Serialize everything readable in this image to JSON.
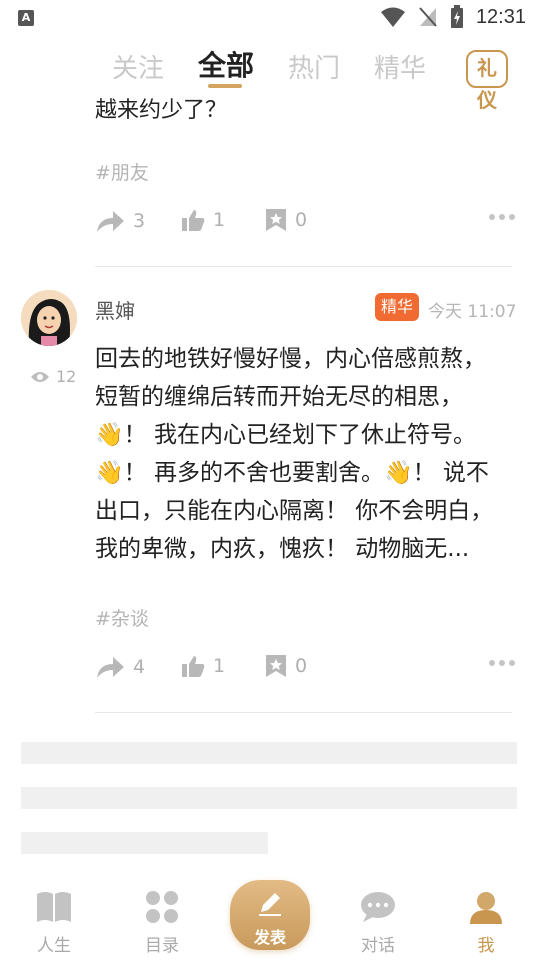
{
  "status": {
    "time": "12:31",
    "left_icon": "A"
  },
  "tabs": [
    {
      "label": "关注"
    },
    {
      "label": "全部"
    },
    {
      "label": "热门"
    },
    {
      "label": "精华"
    }
  ],
  "liyi_label": "礼仪",
  "post_prev": {
    "cut_text": "越来约少了？",
    "tag": "#朋友",
    "repost_count": "3",
    "like_count": "1",
    "fav_count": "0"
  },
  "post": {
    "author": "黑婶",
    "badge": "精华",
    "time": "今天 11:07",
    "views": "12",
    "lines": [
      "回去的地铁好慢好慢，内心倍感煎熬，",
      "短暂的缠绵后转而开始无尽的相思，",
      "👋！ 我在内心已经划下了休止符号。",
      "👋！ 再多的不舍也要割舍。👋！  说不",
      "出口，只能在内心隔离！ 你不会明白，",
      "我的卑微，内疚，愧疚！  动物脑无..."
    ],
    "tag": "#杂谈",
    "repost_count": "4",
    "like_count": "1",
    "fav_count": "0"
  },
  "nav": {
    "items": [
      {
        "label": "人生"
      },
      {
        "label": "目录"
      },
      {
        "label": "发表"
      },
      {
        "label": "对话"
      },
      {
        "label": "我"
      }
    ]
  },
  "colors": {
    "accent": "#c9964f",
    "badge": "#f06a32",
    "muted": "#b0b0b0"
  }
}
